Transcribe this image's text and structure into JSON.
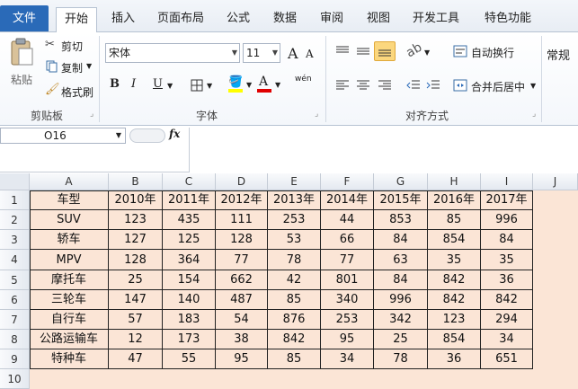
{
  "tabs": [
    "文件",
    "开始",
    "插入",
    "页面布局",
    "公式",
    "数据",
    "审阅",
    "视图",
    "开发工具",
    "特色功能"
  ],
  "ribbon": {
    "clipboard": {
      "paste": "粘贴",
      "cut": "剪切",
      "copy": "复制",
      "format_painter": "格式刷",
      "label": "剪贴板"
    },
    "font": {
      "name": "宋体",
      "size": "11",
      "label": "字体",
      "bold": "B",
      "italic": "I",
      "underline": "U",
      "grow": "A",
      "shrink": "A",
      "wen": "wén"
    },
    "alignment": {
      "wrap": "自动换行",
      "merge": "合并后居中",
      "label": "对齐方式"
    },
    "number": {
      "format": "常规"
    }
  },
  "namebox": "O16",
  "fx": "fx",
  "columns": [
    "A",
    "B",
    "C",
    "D",
    "E",
    "F",
    "G",
    "H",
    "I",
    "J"
  ],
  "rows": [
    "1",
    "2",
    "3",
    "4",
    "5",
    "6",
    "7",
    "8",
    "9",
    "10"
  ],
  "table": {
    "header": [
      "车型",
      "2010年",
      "2011年",
      "2012年",
      "2013年",
      "2014年",
      "2015年",
      "2016年",
      "2017年"
    ],
    "body": [
      [
        "SUV",
        "123",
        "435",
        "111",
        "253",
        "44",
        "853",
        "85",
        "996"
      ],
      [
        "轿车",
        "127",
        "125",
        "128",
        "53",
        "66",
        "84",
        "854",
        "84"
      ],
      [
        "MPV",
        "128",
        "364",
        "77",
        "78",
        "77",
        "63",
        "35",
        "35"
      ],
      [
        "摩托车",
        "25",
        "154",
        "662",
        "42",
        "801",
        "84",
        "842",
        "36"
      ],
      [
        "三轮车",
        "147",
        "140",
        "487",
        "85",
        "340",
        "996",
        "842",
        "842"
      ],
      [
        "自行车",
        "57",
        "183",
        "54",
        "876",
        "253",
        "342",
        "123",
        "294"
      ],
      [
        "公路运输车",
        "12",
        "173",
        "38",
        "842",
        "95",
        "25",
        "854",
        "34"
      ],
      [
        "特种车",
        "47",
        "55",
        "95",
        "85",
        "34",
        "78",
        "36",
        "651"
      ]
    ]
  },
  "colors": {
    "cell_fill": "#fbe5d6",
    "file_tab": "#2a6ab8",
    "font_color_bar": "#e00000",
    "fill_color_bar": "#ffff00"
  }
}
